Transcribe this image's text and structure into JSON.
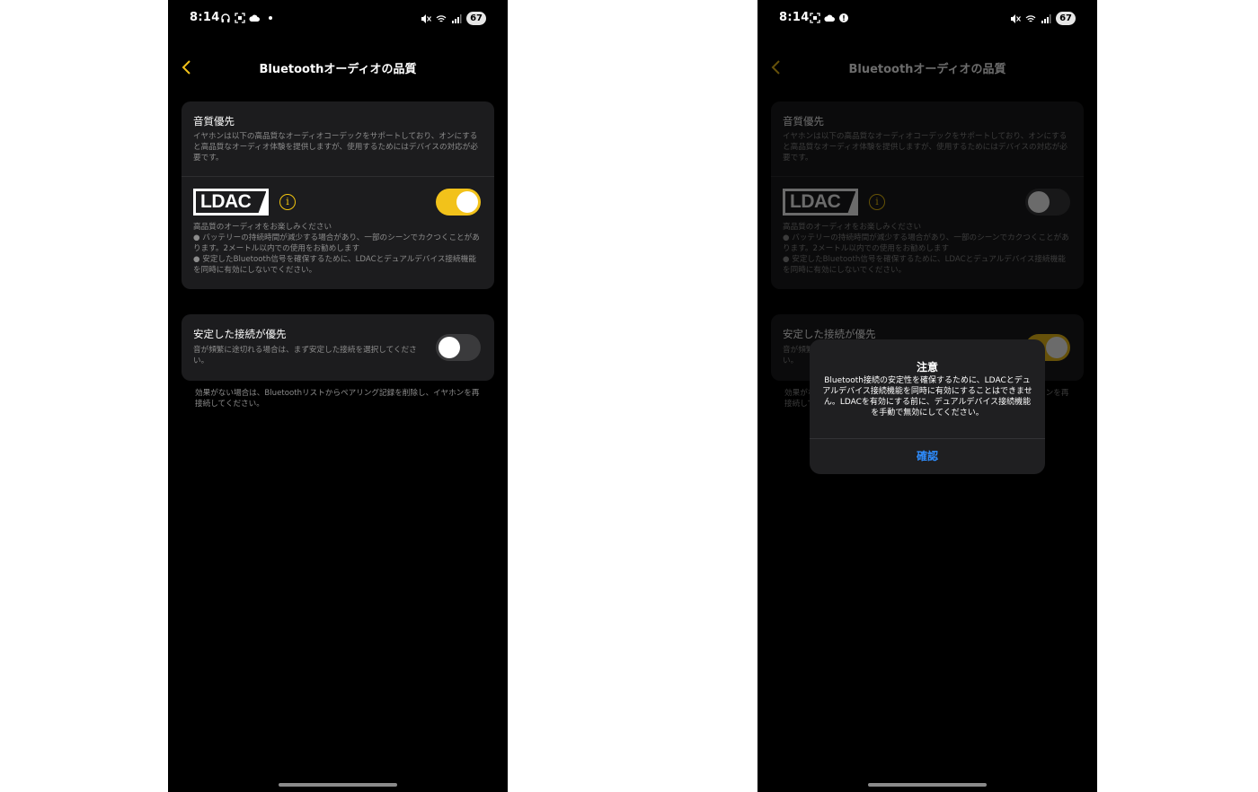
{
  "status_bar": {
    "time": "8:14",
    "battery": "67"
  },
  "header": {
    "title": "Bluetoothオーディオの品質"
  },
  "quality_card": {
    "title": "音質優先",
    "description": "イヤホンは以下の高品質なオーディオコーデックをサポートしており、オンにすると高品質なオーディオ体験を提供しますが、使用するためにはデバイスの対応が必要です。",
    "ldac_logo_text": "LDAC",
    "info_symbol": "i",
    "ldac_desc_line1": "高品質のオーディオをお楽しみください",
    "ldac_desc_line2": "● バッテリーの持続時間が減少する場合があり、一部のシーンでカクつくことがあります。2メートル以内での使用をお勧めします",
    "ldac_desc_line3": "● 安定したBluetooth信号を確保するために、LDACとデュアルデバイス接続機能を同時に有効にしないでください。"
  },
  "stable_card": {
    "title": "安定した接続が優先",
    "description": "音が頻繁に途切れる場合は、まず安定した接続を選択してください。"
  },
  "footer_note": "効果がない場合は、Bluetoothリストからペアリング記録を削除し、イヤホンを再接続してください。",
  "toggles": {
    "left_ldac": "on",
    "left_stable": "off",
    "right_ldac": "off",
    "right_stable": "on"
  },
  "dialog": {
    "title": "注意",
    "message": "Bluetooth接続の安定性を確保するために、LDACとデュアルデバイス接続機能を同時に有効にすることはできません。LDACを有効にする前に、デュアルデバイス接続機能を手動で無効にしてください。",
    "confirm_label": "確認"
  },
  "colors": {
    "accent": "#f2c21a",
    "background": "#000000",
    "card": "#1c1c1e",
    "secondary_text": "#8c8c8c",
    "link_blue": "#2e8dff"
  },
  "icons": {
    "status_left_phone": [
      "headphones-icon",
      "screenshot-icon",
      "cloud-icon",
      "dot-icon"
    ],
    "status_right_phone": [
      "screenshot-icon",
      "cloud-icon",
      "alert-icon"
    ],
    "status_right": [
      "mute-icon",
      "wifi-icon",
      "signal-icon",
      "battery-icon"
    ],
    "back": "chevron-left-icon",
    "info": "info-icon"
  }
}
